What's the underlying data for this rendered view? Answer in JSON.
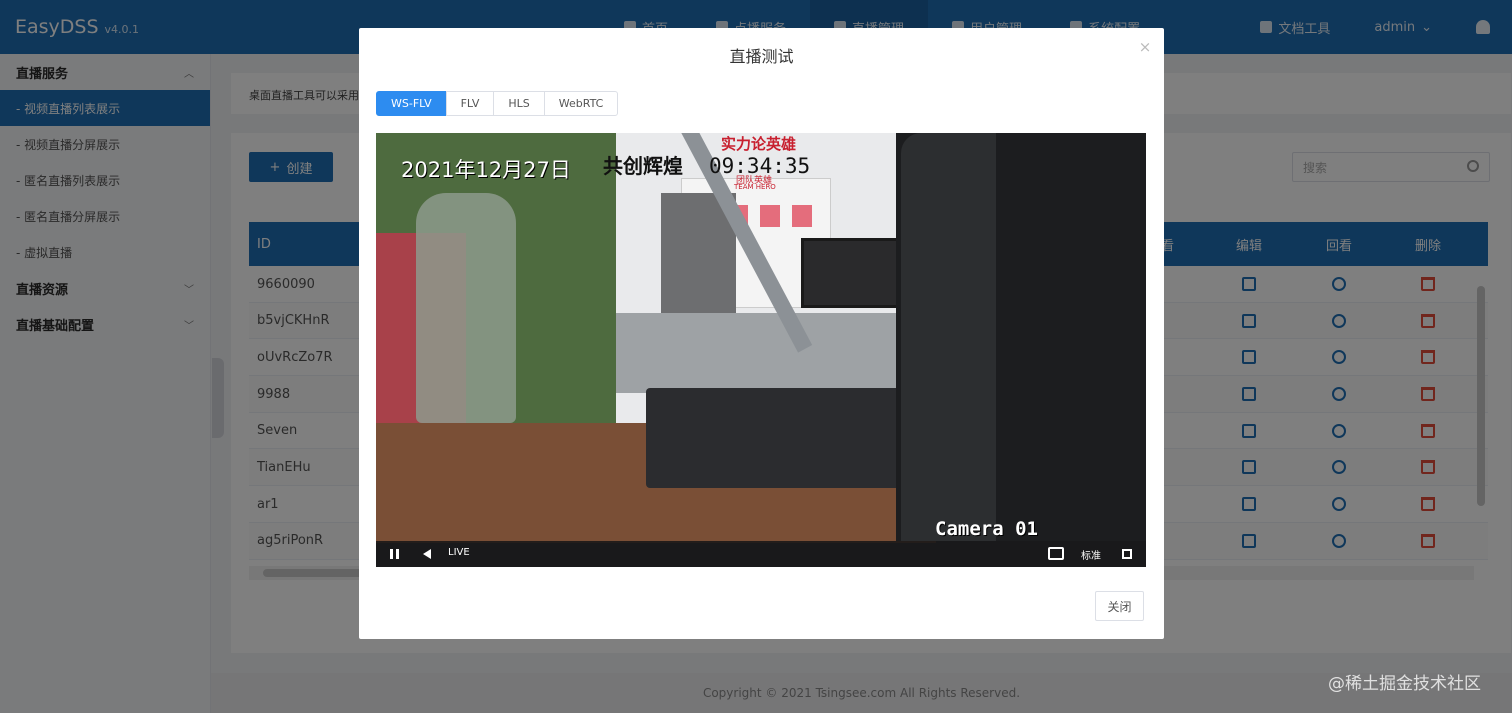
{
  "app": {
    "name": "EasyDSS",
    "version": "v4.0.1"
  },
  "topnav": {
    "items": [
      {
        "label": "首页"
      },
      {
        "label": "点播服务"
      },
      {
        "label": "直播管理"
      },
      {
        "label": "用户管理"
      },
      {
        "label": "系统配置"
      }
    ],
    "docs_label": "文档工具",
    "user_label": "admin"
  },
  "sidebar": {
    "groups": [
      {
        "label": "直播服务",
        "items": [
          {
            "label": "- 视频直播列表展示"
          },
          {
            "label": "- 视频直播分屏展示"
          },
          {
            "label": "- 匿名直播列表展示"
          },
          {
            "label": "- 匿名直播分屏展示"
          },
          {
            "label": "- 虚拟直播"
          }
        ]
      },
      {
        "label": "直播资源"
      },
      {
        "label": "直播基础配置"
      }
    ]
  },
  "notice": "桌面直播工具可以采用",
  "toolbar": {
    "create_label": "创建",
    "search_placeholder": "搜索"
  },
  "table": {
    "headers": {
      "id": "ID",
      "edit": "编辑",
      "playback": "回看",
      "delete": "删除",
      "partial": "看"
    },
    "rows": [
      {
        "id": "9660090"
      },
      {
        "id": "b5vjCKHnR"
      },
      {
        "id": "oUvRcZo7R"
      },
      {
        "id": "9988"
      },
      {
        "id": "Seven"
      },
      {
        "id": "TianEHu"
      },
      {
        "id": "ar1"
      },
      {
        "id": "ag5riPonR"
      }
    ]
  },
  "footer": {
    "copyright": "Copyright © 2021 Tsingsee.com All Rights Reserved."
  },
  "modal": {
    "title": "直播测试",
    "close_glyph": "×",
    "tabs": [
      {
        "label": "WS-FLV",
        "active": true
      },
      {
        "label": "FLV",
        "active": false
      },
      {
        "label": "HLS",
        "active": false
      },
      {
        "label": "WebRTC",
        "active": false
      }
    ],
    "video": {
      "osd_date": "2021年12月27日",
      "osd_title": "共创辉煌",
      "osd_time": "09:34:35",
      "osd_slogan": "实力论英雄",
      "osd_team": "团队英雄",
      "osd_team_en": "TEAM HERO",
      "osd_camera": "Camera 01",
      "controls": {
        "live_label": "LIVE",
        "quality_label": "标准"
      }
    },
    "close_button_label": "关闭"
  },
  "watermark": "@稀土掘金技术社区",
  "colors": {
    "primary": "#1f6fb5",
    "tab_active": "#2d8cf0",
    "danger": "#e24c3b"
  }
}
